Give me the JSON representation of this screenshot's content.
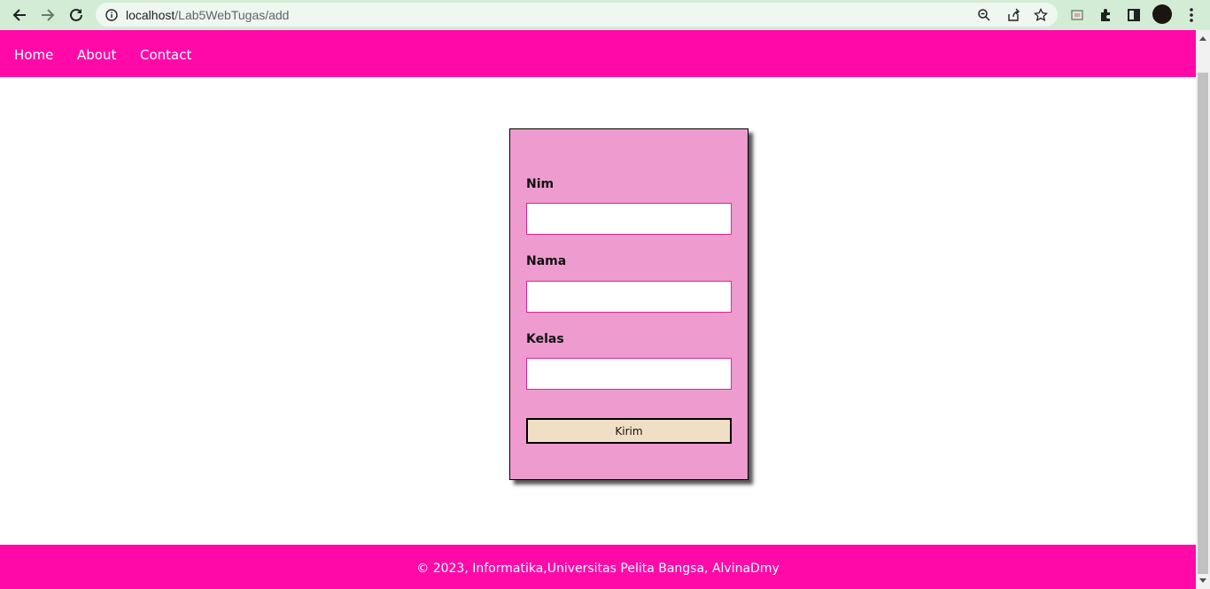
{
  "browser": {
    "url_host": "localhost",
    "url_path": "/Lab5WebTugas/add"
  },
  "nav": {
    "items": [
      {
        "label": "Home"
      },
      {
        "label": "About"
      },
      {
        "label": "Contact"
      }
    ]
  },
  "form": {
    "fields": [
      {
        "label": "Nim",
        "value": ""
      },
      {
        "label": "Nama",
        "value": ""
      },
      {
        "label": "Kelas",
        "value": ""
      }
    ],
    "submit_label": "Kirim"
  },
  "footer": {
    "text": "© 2023, Informatika,Universitas Pelita Bangsa, AlvinaDmy"
  },
  "colors": {
    "brand": "#ff0aa8",
    "card_bg": "#ee9ccf",
    "button_bg": "#f0dfc4"
  }
}
